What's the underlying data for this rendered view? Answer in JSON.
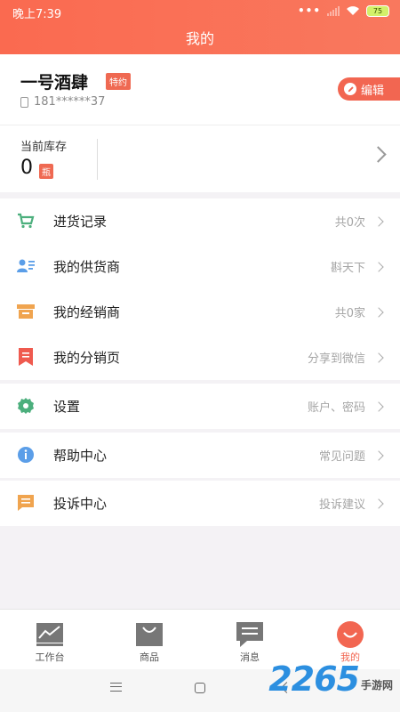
{
  "status_bar": {
    "time": "晚上7:39",
    "battery": "75"
  },
  "header": {
    "title": "我的"
  },
  "profile": {
    "shop_name": "一号酒肆",
    "badge": "特约",
    "phone": "181******37",
    "edit_label": "编辑"
  },
  "stock": {
    "label": "当前库存",
    "count": "0",
    "unit": "瓶"
  },
  "menu_group_1": [
    {
      "label": "进货记录",
      "value": "共0次",
      "icon": "cart-icon",
      "color": "#4caf7d"
    },
    {
      "label": "我的供货商",
      "value": "斟天下",
      "icon": "supplier-icon",
      "color": "#5b9ee8"
    },
    {
      "label": "我的经销商",
      "value": "共0家",
      "icon": "store-icon",
      "color": "#f0a44f"
    },
    {
      "label": "我的分销页",
      "value": "分享到微信",
      "icon": "bookmark-icon",
      "color": "#ef5a4f"
    }
  ],
  "menu_group_2": [
    {
      "label": "设置",
      "value": "账户、密码",
      "icon": "gear-icon",
      "color": "#4caf7d"
    }
  ],
  "menu_group_3": [
    {
      "label": "帮助中心",
      "value": "常见问题",
      "icon": "info-icon",
      "color": "#5b9ee8"
    }
  ],
  "menu_group_4": [
    {
      "label": "投诉中心",
      "value": "投诉建议",
      "icon": "message-icon",
      "color": "#f0a44f"
    }
  ],
  "tabs": [
    {
      "label": "工作台",
      "icon": "chart-icon",
      "active": false
    },
    {
      "label": "商品",
      "icon": "bag-icon",
      "active": false
    },
    {
      "label": "消息",
      "icon": "chat-icon",
      "active": false
    },
    {
      "label": "我的",
      "icon": "smile-icon",
      "active": true
    }
  ],
  "watermark": {
    "number": "2265",
    "text": "手游网"
  }
}
